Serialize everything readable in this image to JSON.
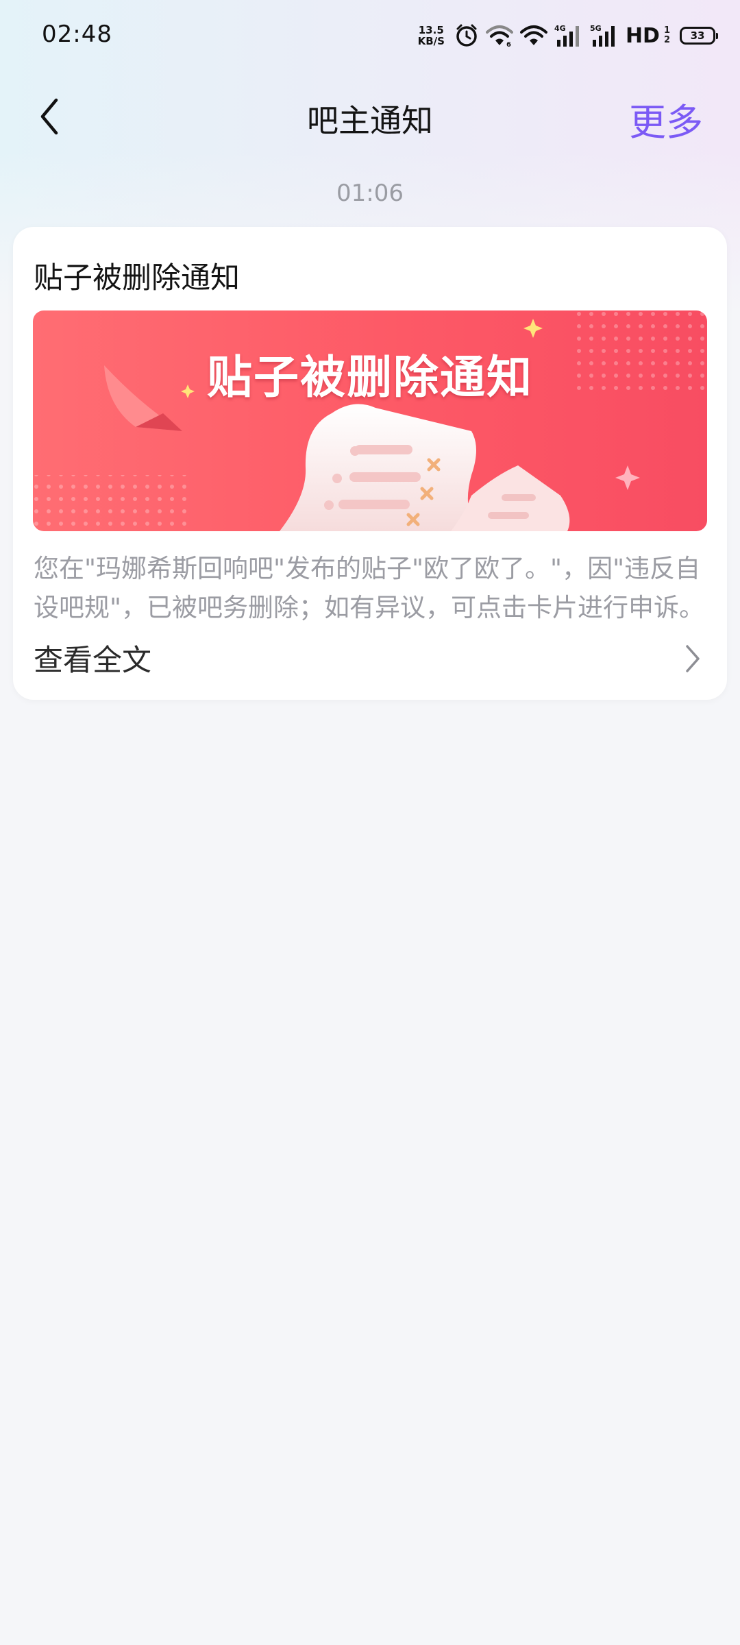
{
  "status_bar": {
    "time": "02:48",
    "net_speed_value": "13.5",
    "net_speed_unit": "KB/S",
    "signal_4g": "4G",
    "signal_5g": "5G",
    "hd_label": "HD",
    "hd_sub_top": "1",
    "hd_sub_bottom": "2",
    "battery": "33"
  },
  "header": {
    "title": "吧主通知",
    "more_label": "更多"
  },
  "timestamp": "01:06",
  "notification": {
    "title": "贴子被删除通知",
    "banner_text": "贴子被删除通知",
    "body": "您在\"玛娜希斯回响吧\"发布的贴子\"欧了欧了。\"，因\"违反自设吧规\"，已被吧务删除；如有异议，可点击卡片进行申诉。",
    "view_full_label": "查看全文"
  },
  "colors": {
    "accent": "#7b5af5",
    "banner_red": "#fd5966",
    "page_background": "#f5f6f9"
  }
}
